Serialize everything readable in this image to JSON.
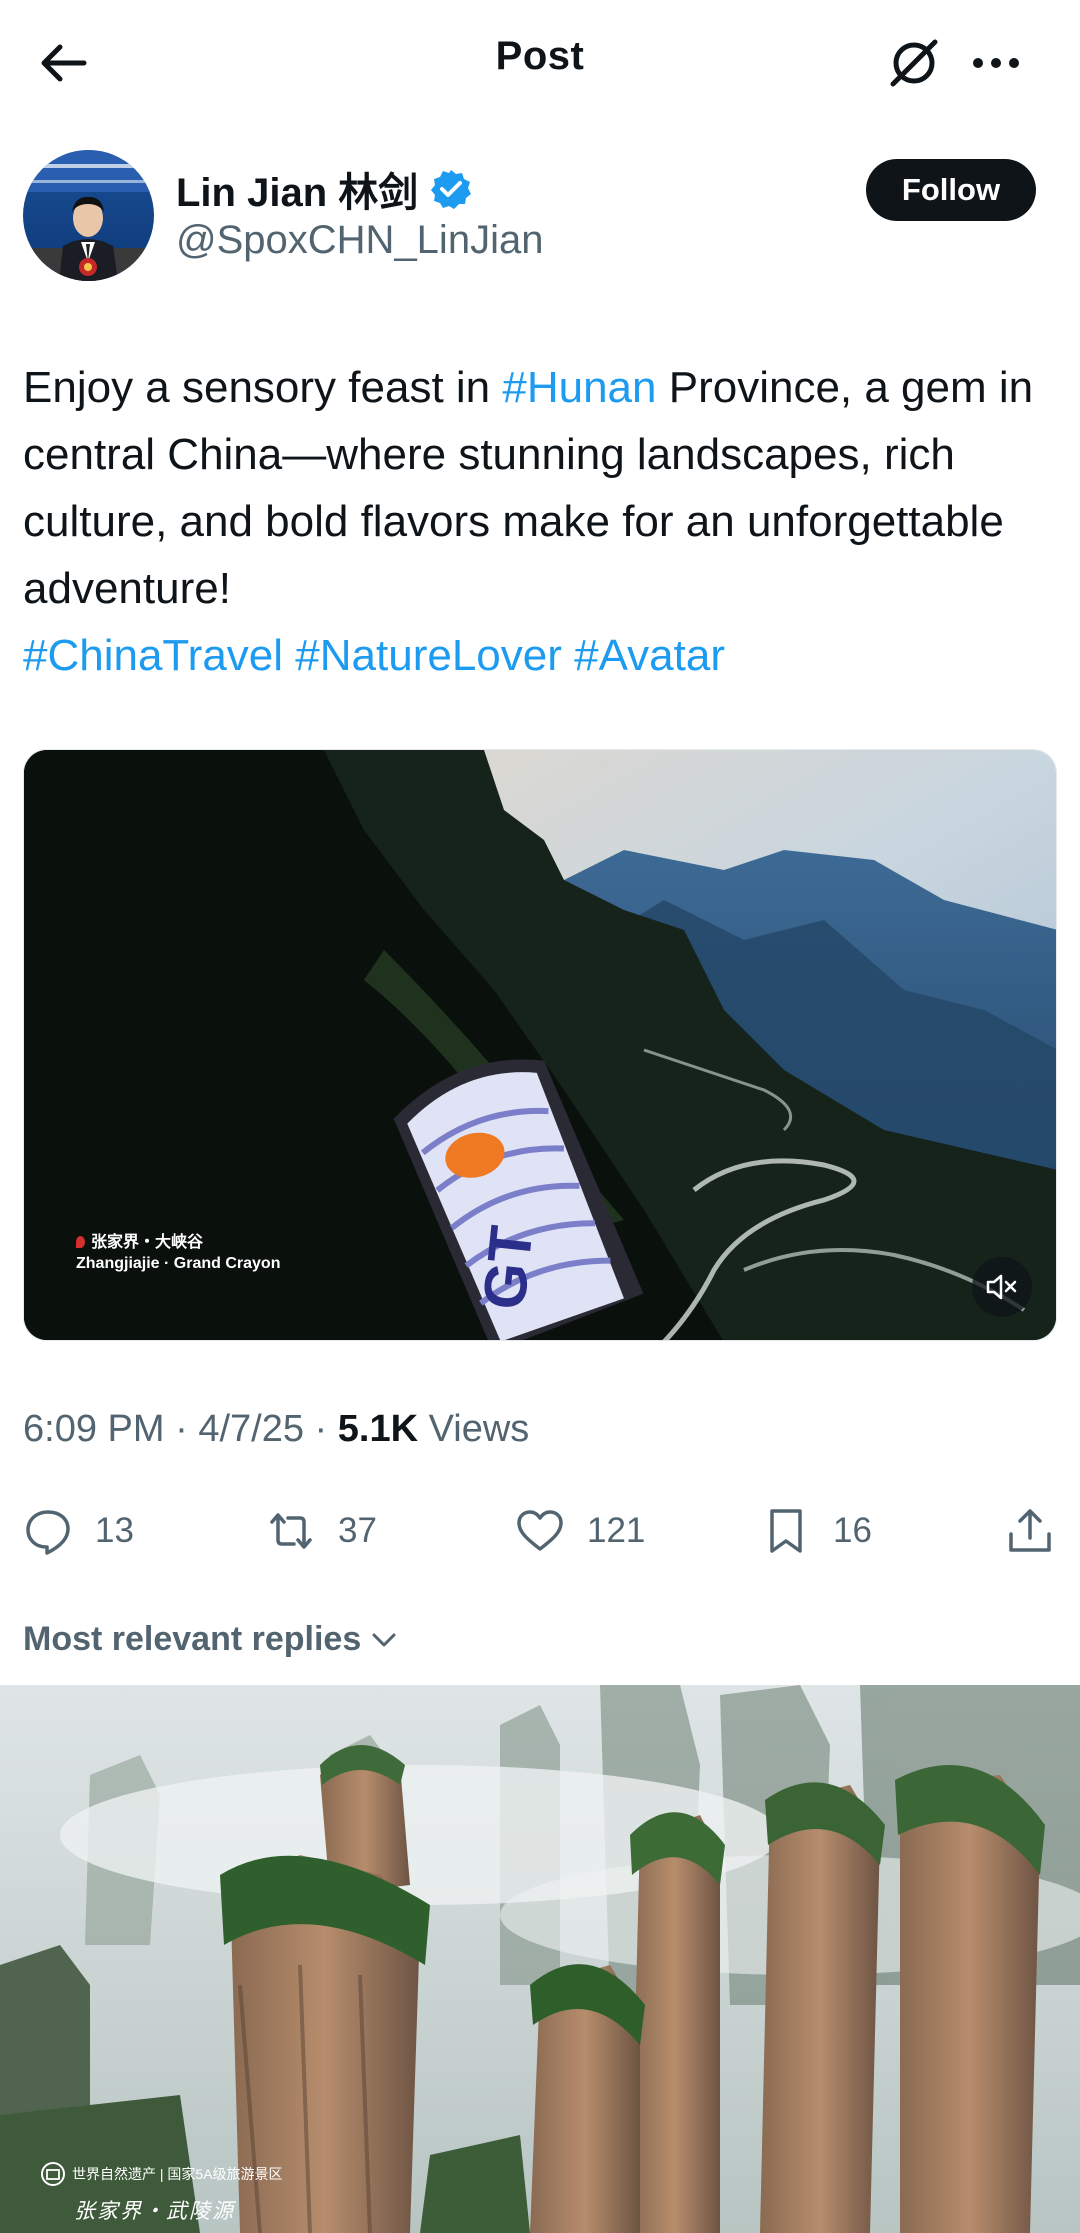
{
  "header": {
    "title": "Post",
    "icons": {
      "back": "arrow-left-icon",
      "grok": "grok-icon",
      "more": "more-icon"
    }
  },
  "author": {
    "name": "Lin Jian 林剑",
    "handle": "@SpoxCHN_LinJian",
    "verified": true,
    "follow_label": "Follow"
  },
  "post": {
    "segments": [
      {
        "text": "Enjoy a sensory feast in ",
        "type": "text"
      },
      {
        "text": "#Hunan",
        "type": "hashtag"
      },
      {
        "text": " Province, a gem in central China—where stunning landscapes, rich culture, and bold flavors make for an unforgettable adventure!",
        "type": "text"
      },
      {
        "text": "#ChinaTravel",
        "type": "hashtag"
      },
      {
        "text": "#NatureLover",
        "type": "hashtag"
      },
      {
        "text": "#Avatar",
        "type": "hashtag"
      }
    ],
    "video_caption_cn": "张家界・大峡谷",
    "video_caption_en": "Zhangjiajie · Grand Crayon"
  },
  "meta": {
    "time": "6:09 PM",
    "date": "4/7/25",
    "views_count": "5.1K",
    "views_label": "Views",
    "separator": "·"
  },
  "actions": {
    "replies": "13",
    "reposts": "37",
    "likes": "121",
    "bookmarks": "16"
  },
  "replies": {
    "sort_label": "Most relevant replies",
    "logo_line1": "世界自然遗产 | 国家5A级旅游景区",
    "logo_line2": "张家界・武陵源"
  },
  "colors": {
    "accent": "#1d9bf0",
    "text": "#0f1419",
    "secondary": "#536471",
    "button_bg": "#0f1419"
  }
}
